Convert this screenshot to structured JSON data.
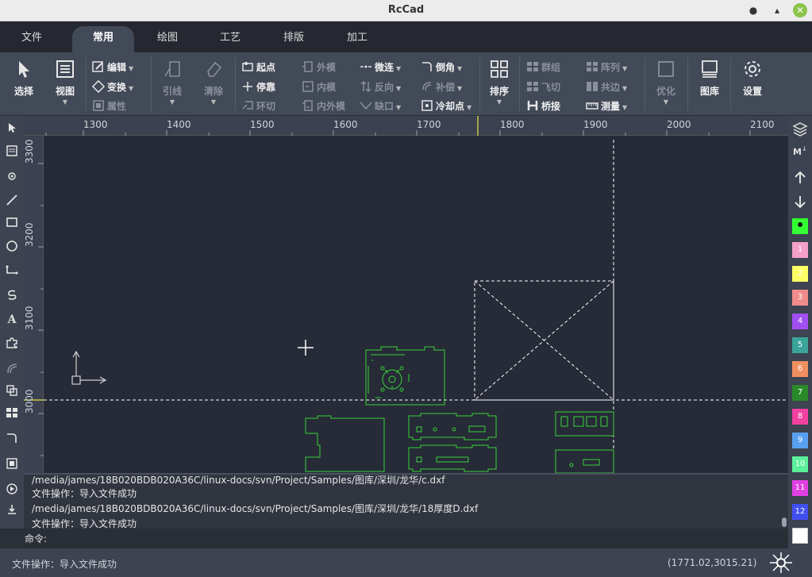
{
  "window": {
    "title": "RcCad",
    "minimize": "●",
    "restore": "▴",
    "close": "✕"
  },
  "menu": {
    "tabs": [
      {
        "label": "文件"
      },
      {
        "label": "常用"
      },
      {
        "label": "绘图"
      },
      {
        "label": "工艺"
      },
      {
        "label": "排版"
      },
      {
        "label": "加工"
      }
    ],
    "active": "常用"
  },
  "ribbon": {
    "select": "选择",
    "view": "视图",
    "edit": "编辑",
    "transform": "变换",
    "property": "属性",
    "lead": "引线",
    "clear": "清除",
    "start": "起点",
    "stop": "停靠",
    "loop_cut": "环切",
    "outer": "外模",
    "inner": "内模",
    "inner_outer": "内外模",
    "micro": "微连",
    "reverse": "反向",
    "notch": "缺口",
    "chamfer": "倒角",
    "compensate": "补偿",
    "cool_point": "冷却点",
    "sort": "排序",
    "group": "群组",
    "fly_cut": "飞切",
    "bridge": "桥接",
    "array": "阵列",
    "common_edge": "共边",
    "measure": "测量",
    "optimize": "优化",
    "gallery": "图库",
    "settings": "设置"
  },
  "ruler": {
    "h_labels": [
      "1300",
      "1400",
      "1500",
      "1600",
      "1700",
      "1800",
      "1900",
      "2000",
      "2100"
    ],
    "v_labels": [
      "3300",
      "3200",
      "3100",
      "3000"
    ]
  },
  "layers": [
    "",
    "1",
    "2",
    "3",
    "4",
    "5",
    "6",
    "7",
    "8",
    "9",
    "10",
    "11",
    "12",
    ""
  ],
  "layer_colors": [
    "#33ff33",
    "#f4a0c8",
    "#ffff66",
    "#f08c8c",
    "#a050f0",
    "#3aa39a",
    "#f09060",
    "#2a8a2a",
    "#f040a0",
    "#5aa0f0",
    "#5af09a",
    "#e040e0",
    "#4050f0",
    "#ffffff"
  ],
  "log": [
    "/media/james/18B020BDB020A36C/linux-docs/svn/Project/Samples/图库/深圳/龙华/c.dxf",
    "文件操作：导入文件成功",
    "/media/james/18B020BDB020A36C/linux-docs/svn/Project/Samples/图库/深圳/龙华/18厚度D.dxf",
    "文件操作：导入文件成功"
  ],
  "command": {
    "label": "命令:",
    "value": ""
  },
  "status": {
    "message": "文件操作：导入文件成功",
    "coords": "(1771.02,3015.21)"
  },
  "colors": {
    "geometry": "#38d13a",
    "guides": "#ffffff"
  }
}
